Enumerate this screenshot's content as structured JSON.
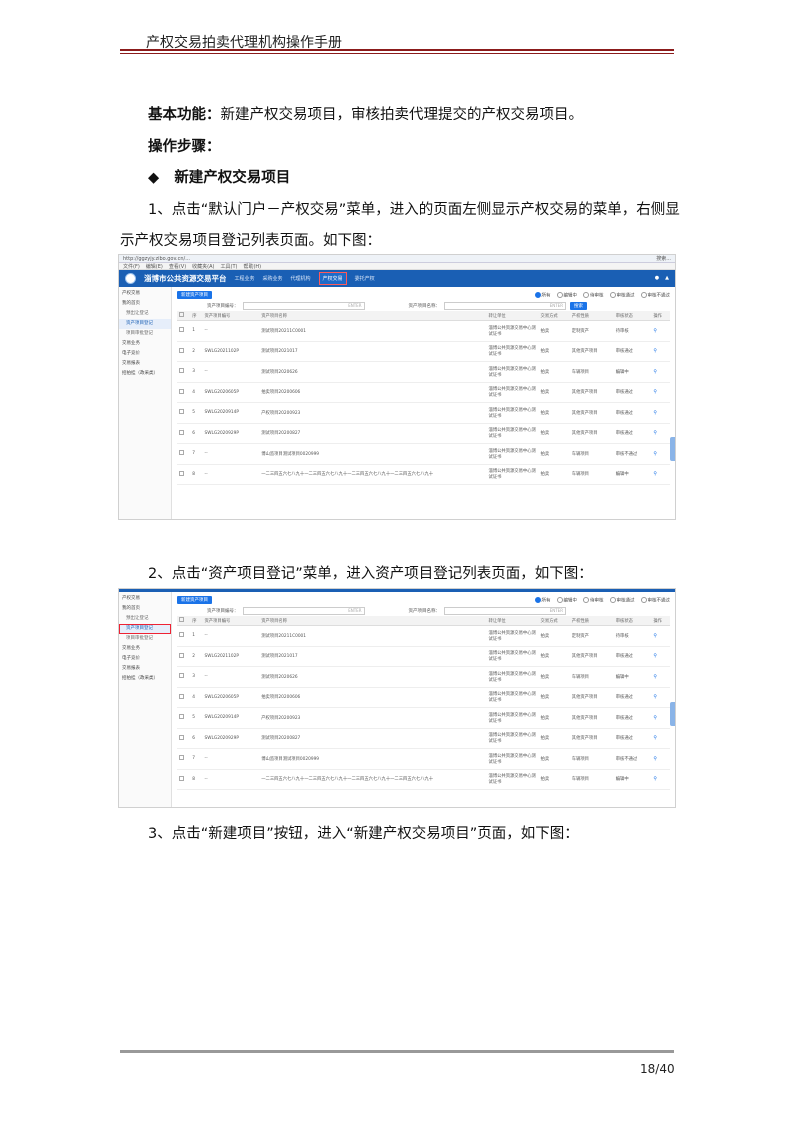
{
  "header": {
    "title": "产权交易拍卖代理机构操作手册"
  },
  "intro": {
    "func_label": "基本功能：",
    "func_text": "新建产权交易项目，审核拍卖代理提交的产权交易项目。",
    "steps_label": "操作步骤：",
    "section_bullet": "◆",
    "section_title": "新建产权交易项目",
    "step1_line1": "1、点击“默认门户－产权交易”菜单，进入的页面左侧显示产权交易的菜单，右侧显",
    "step1_line2": "示产权交易项目登记列表页面。如下图：",
    "step2": "2、点击“资产项目登记”菜单，进入资产项目登记列表页面，如下图：",
    "step3": "3、点击“新建项目”按钮，进入“新建产权交易项目”页面，如下图："
  },
  "screenshot": {
    "browser_url": "http://ggzyjy.zibo.gov.cn/...",
    "browser_search": "搜索...",
    "menu": [
      "文件(F)",
      "编辑(E)",
      "查看(V)",
      "收藏夹(A)",
      "工具(T)",
      "帮助(H)"
    ],
    "app_name": "淄博市公共资源交易平台",
    "nav": [
      "工程业务",
      "采购业务",
      "代理机构",
      "产权交易",
      "委托产权"
    ],
    "sidebar": [
      "产权交易",
      "我的首页",
      "预出让登记",
      "资产项目登记",
      "项目审批登记",
      "交易业务",
      "电子竞价",
      "交易报表",
      "招拍挂（政采类）"
    ],
    "new_button": "新建资产项目",
    "filters": [
      "所有",
      "编辑中",
      "待审核",
      "审核通过",
      "审核不通过"
    ],
    "search_code_label": "资产项目编号：",
    "search_name_label": "资产项目名称：",
    "enter_hint": "ENTER",
    "search_button": "搜索",
    "columns": [
      "",
      "序",
      "资产项目编号",
      "资产项目名称",
      "转让单位",
      "交易方式",
      "产权性质",
      "审核状态",
      "操作"
    ],
    "rows": [
      [
        "1",
        "--",
        "测试项目20211C0001",
        "淄博公共资源交易中心测试证书",
        "拍卖",
        "定制资产",
        "待审核"
      ],
      [
        "2",
        "SWLG2021102P",
        "测试项目2021017",
        "淄博公共资源交易中心测试证书",
        "拍卖",
        "其他资产项目",
        "审核通过"
      ],
      [
        "3",
        "--",
        "测试项目2020626",
        "淄博公共资源交易中心测试证书",
        "拍卖",
        "车辆项目",
        "编辑中"
      ],
      [
        "4",
        "SWLG2020605P",
        "拍卖项目20200606",
        "淄博公共资源交易中心测试证书",
        "拍卖",
        "其他资产项目",
        "审核通过"
      ],
      [
        "5",
        "SWLG2020914P",
        "产权项目20200923",
        "淄博公共资源交易中心测试证书",
        "拍卖",
        "其他资产项目",
        "审核通过"
      ],
      [
        "6",
        "SWLG2020929P",
        "测试项目20200827",
        "淄博公共资源交易中心测试证书",
        "拍卖",
        "其他资产项目",
        "审核通过"
      ],
      [
        "7",
        "--",
        "博山监项目测试项目0020999",
        "淄博公共资源交易中心测试证书",
        "拍卖",
        "车辆项目",
        "审核不通过"
      ],
      [
        "8",
        "--",
        "一二三四五六七八九十一二三四五六七八九十一二三四五六七八九十一二三四五六七八九十",
        "淄博公共资源交易中心测试证书",
        "拍卖",
        "车辆项目",
        "编辑中"
      ]
    ]
  },
  "footer": {
    "page": "18/40"
  }
}
